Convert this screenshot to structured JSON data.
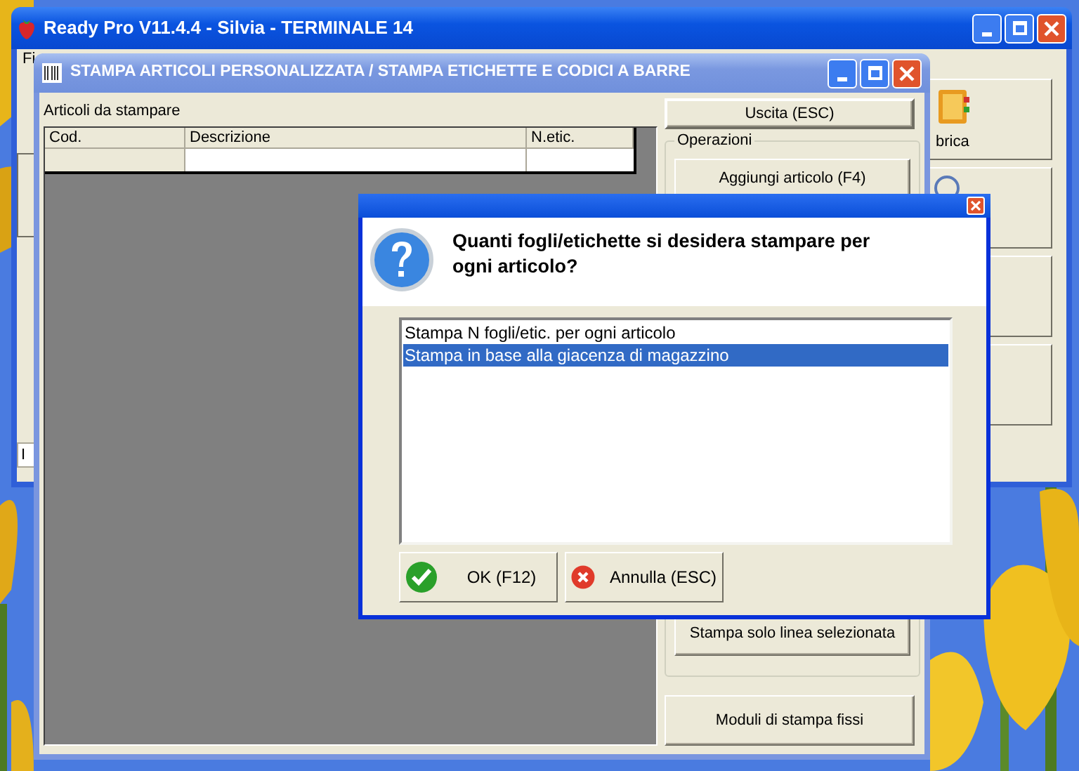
{
  "main_window": {
    "title": "Ready Pro V11.4.4 - Silvia - TERMINALE 14",
    "menu": [
      "Fi"
    ],
    "side_button_label": "brica",
    "left_panel_label": "I"
  },
  "print_window": {
    "title": "STAMPA ARTICOLI PERSONALIZZATA / STAMPA ETICHETTE E CODICI A BARRE",
    "list_label": "Articoli da stampare",
    "table": {
      "columns": [
        "Cod.",
        "Descrizione",
        "N.etic."
      ]
    },
    "exit_button": "Uscita (ESC)",
    "group_title": "Operazioni",
    "group_buttons": [
      "Aggiungi articolo (F4)",
      "Stampa solo linea selezionata"
    ],
    "bottom_button": "Moduli di stampa fissi"
  },
  "dialog": {
    "question": "Quanti fogli/etichette si desidera stampare per ogni articolo?",
    "options": [
      {
        "label": "Stampa N fogli/etic. per ogni articolo",
        "selected": false
      },
      {
        "label": "Stampa in base alla giacenza di magazzino",
        "selected": true
      }
    ],
    "buttons": [
      {
        "label": "OK (F12)",
        "kind": "ok"
      },
      {
        "label": "Annulla (ESC)",
        "kind": "cancel"
      }
    ]
  }
}
